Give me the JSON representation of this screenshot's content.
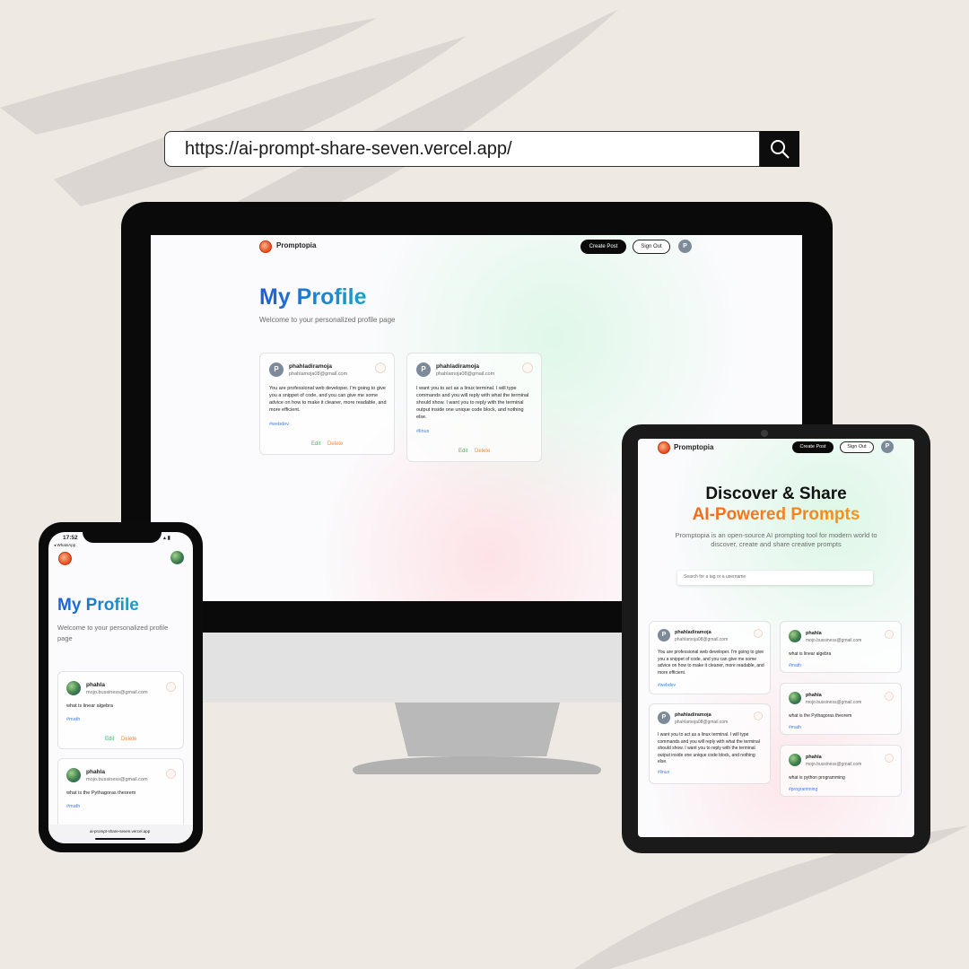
{
  "url_bar": {
    "url": "https://ai-prompt-share-seven.vercel.app/",
    "search_icon": "search-icon"
  },
  "app": {
    "brand": "Promptopia",
    "create_post": "Create Post",
    "sign_out": "Sign Out",
    "avatar_initial": "P"
  },
  "desktop": {
    "title": "My Profile",
    "subtitle": "Welcome to your personalized profile page",
    "cards": [
      {
        "avatar": "P",
        "username": "phahladiramoja",
        "email": "phahlamoja08@gmail.com",
        "body": "You are professional web developer. I'm going to give you a snippet of code, and you can give me some advice on how to make it cleaner, more readable, and more efficient.",
        "tag": "#webdev",
        "edit": "Edit",
        "delete": "Delete"
      },
      {
        "avatar": "P",
        "username": "phahladiramoja",
        "email": "phahlamoja08@gmail.com",
        "body": "I want you to act as a linux terminal. I will type commands and you will reply with what the terminal should show. I want you to reply with the terminal output inside one unique code block, and nothing else.",
        "tag": "#linux",
        "edit": "Edit",
        "delete": "Delete"
      }
    ]
  },
  "phone": {
    "time": "17:52",
    "back_app": "◂ WhatsApp",
    "title": "My Profile",
    "subtitle": "Welcome to your personalized profile page",
    "cards": [
      {
        "username": "phahla",
        "email": "mojo.bussiness@gmail.com",
        "body": "what is linear algebra",
        "tag": "#math",
        "edit": "Edit",
        "delete": "Delete"
      },
      {
        "username": "phahla",
        "email": "mojo.bussiness@gmail.com",
        "body": "what is the Pythagoras theorem",
        "tag": "#math"
      }
    ],
    "address": "ai-prompt-share-seven.vercel.app"
  },
  "tablet": {
    "hero_line1": "Discover & Share",
    "hero_line2": "AI-Powered Prompts",
    "description": "Promptopia is an open-source AI prompting tool for modern world to discover, create and share creative prompts",
    "search_placeholder": "Search for a tag or a username",
    "left_cards": [
      {
        "avatar": "P",
        "username": "phahladiramoja",
        "email": "phahlamoja08@gmail.com",
        "body": "You are professional web developer. I'm going to give you a snippet of code, and you can give me some advice on how to make it cleaner, more readable, and more efficient.",
        "tag": "#webdev"
      },
      {
        "avatar": "P",
        "username": "phahladiramoja",
        "email": "phahlamoja08@gmail.com",
        "body": "I want you to act as a linux terminal. I will type commands and you will reply with what the terminal should show. I want you to reply with the terminal output inside one unique code block, and nothing else.",
        "tag": "#linux"
      }
    ],
    "right_cards": [
      {
        "username": "phahla",
        "email": "mojo.bussiness@gmail.com",
        "body": "what is linear algebra",
        "tag": "#math"
      },
      {
        "username": "phahla",
        "email": "mojo.bussiness@gmail.com",
        "body": "what is the Pythagoras theorem",
        "tag": "#math"
      },
      {
        "username": "phahla",
        "email": "mojo.bussiness@gmail.com",
        "body": "what is python programming",
        "tag": "#programming"
      }
    ]
  }
}
